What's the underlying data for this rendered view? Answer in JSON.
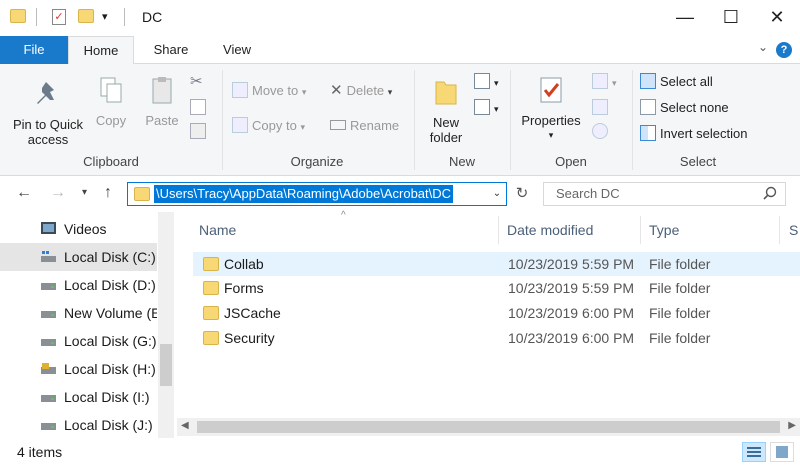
{
  "window": {
    "title": "DC",
    "minimize": "—",
    "maximize": "☐",
    "close": "✕"
  },
  "ribbon_tabs": {
    "file": "File",
    "home": "Home",
    "share": "Share",
    "view": "View"
  },
  "ribbon": {
    "clipboard": {
      "label": "Clipboard",
      "pin_line1": "Pin to Quick",
      "pin_line2": "access",
      "copy": "Copy",
      "paste": "Paste"
    },
    "organize": {
      "label": "Organize",
      "move_to": "Move to",
      "copy_to": "Copy to",
      "delete": "Delete",
      "rename": "Rename"
    },
    "new": {
      "label": "New",
      "new_folder_line1": "New",
      "new_folder_line2": "folder"
    },
    "open": {
      "label": "Open",
      "properties": "Properties"
    },
    "select": {
      "label": "Select",
      "select_all": "Select all",
      "select_none": "Select none",
      "invert": "Invert selection"
    }
  },
  "address": {
    "path": "\\Users\\Tracy\\AppData\\Roaming\\Adobe\\Acrobat\\DC"
  },
  "search": {
    "placeholder": "Search DC"
  },
  "nav_pane": {
    "items": [
      {
        "label": "Videos",
        "icon": "videos-icon"
      },
      {
        "label": "Local Disk (C:)",
        "icon": "drive-c-icon"
      },
      {
        "label": "Local Disk (D:)",
        "icon": "drive-icon"
      },
      {
        "label": "New Volume (E:)",
        "icon": "drive-icon"
      },
      {
        "label": "Local Disk (G:)",
        "icon": "drive-icon"
      },
      {
        "label": "Local Disk (H:)",
        "icon": "locked-drive-icon"
      },
      {
        "label": "Local Disk (I:)",
        "icon": "drive-icon"
      },
      {
        "label": "Local Disk (J:)",
        "icon": "drive-icon"
      }
    ]
  },
  "file_list": {
    "columns": {
      "name": "Name",
      "date": "Date modified",
      "type": "Type",
      "size": "S"
    },
    "rows": [
      {
        "name": "Collab",
        "date": "10/23/2019 5:59 PM",
        "type": "File folder"
      },
      {
        "name": "Forms",
        "date": "10/23/2019 5:59 PM",
        "type": "File folder"
      },
      {
        "name": "JSCache",
        "date": "10/23/2019 6:00 PM",
        "type": "File folder"
      },
      {
        "name": "Security",
        "date": "10/23/2019 6:00 PM",
        "type": "File folder"
      }
    ]
  },
  "status": {
    "count": "4 items"
  },
  "colors": {
    "accent": "#0078d7",
    "file_tab": "#1979ca",
    "folder": "#f8d775",
    "selected_nav": "#e5e5e5",
    "hover_row": "#e5f3ff"
  }
}
